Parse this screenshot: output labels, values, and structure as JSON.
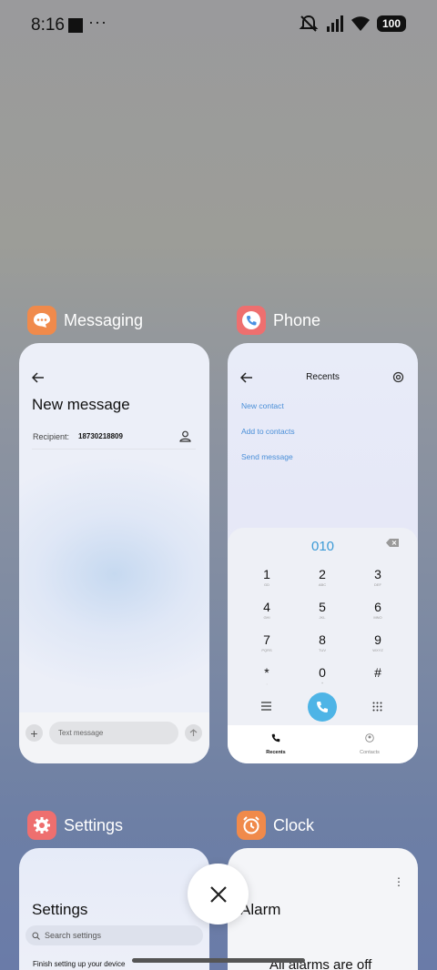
{
  "status_bar": {
    "time": "8:16",
    "dots": "···",
    "battery": "100"
  },
  "apps": {
    "messaging": {
      "name": "Messaging",
      "icon": "chat-bubble-icon",
      "color": "#f08a4b",
      "screen": {
        "title": "New message",
        "recipient_label": "Recipient:",
        "recipient_value": "18730218809",
        "input_placeholder": "Text message"
      }
    },
    "phone": {
      "name": "Phone",
      "icon": "phone-icon",
      "color": "#ee6f6f",
      "screen": {
        "title": "Recents",
        "links": [
          "New contact",
          "Add to contacts",
          "Send message"
        ],
        "dialed": "010",
        "keys": [
          {
            "d": "1",
            "s": "GD"
          },
          {
            "d": "2",
            "s": "ABC"
          },
          {
            "d": "3",
            "s": "DEF"
          },
          {
            "d": "4",
            "s": "GHI"
          },
          {
            "d": "5",
            "s": "JKL"
          },
          {
            "d": "6",
            "s": "MNO"
          },
          {
            "d": "7",
            "s": "PQRS"
          },
          {
            "d": "8",
            "s": "TUV"
          },
          {
            "d": "9",
            "s": "WXYZ"
          },
          {
            "d": "*",
            "s": ","
          },
          {
            "d": "0",
            "s": "+"
          },
          {
            "d": "#",
            "s": ""
          }
        ],
        "tabs": [
          "Recents",
          "Contacts"
        ]
      }
    },
    "settings": {
      "name": "Settings",
      "icon": "gear-icon",
      "color": "#ee6f6f",
      "screen": {
        "title": "Settings",
        "search_placeholder": "Search settings",
        "row": "Finish setting up your device"
      }
    },
    "clock": {
      "name": "Clock",
      "icon": "alarm-clock-icon",
      "color": "#f08a4b",
      "screen": {
        "title": "Alarm",
        "empty_text": "All alarms are off"
      }
    }
  }
}
